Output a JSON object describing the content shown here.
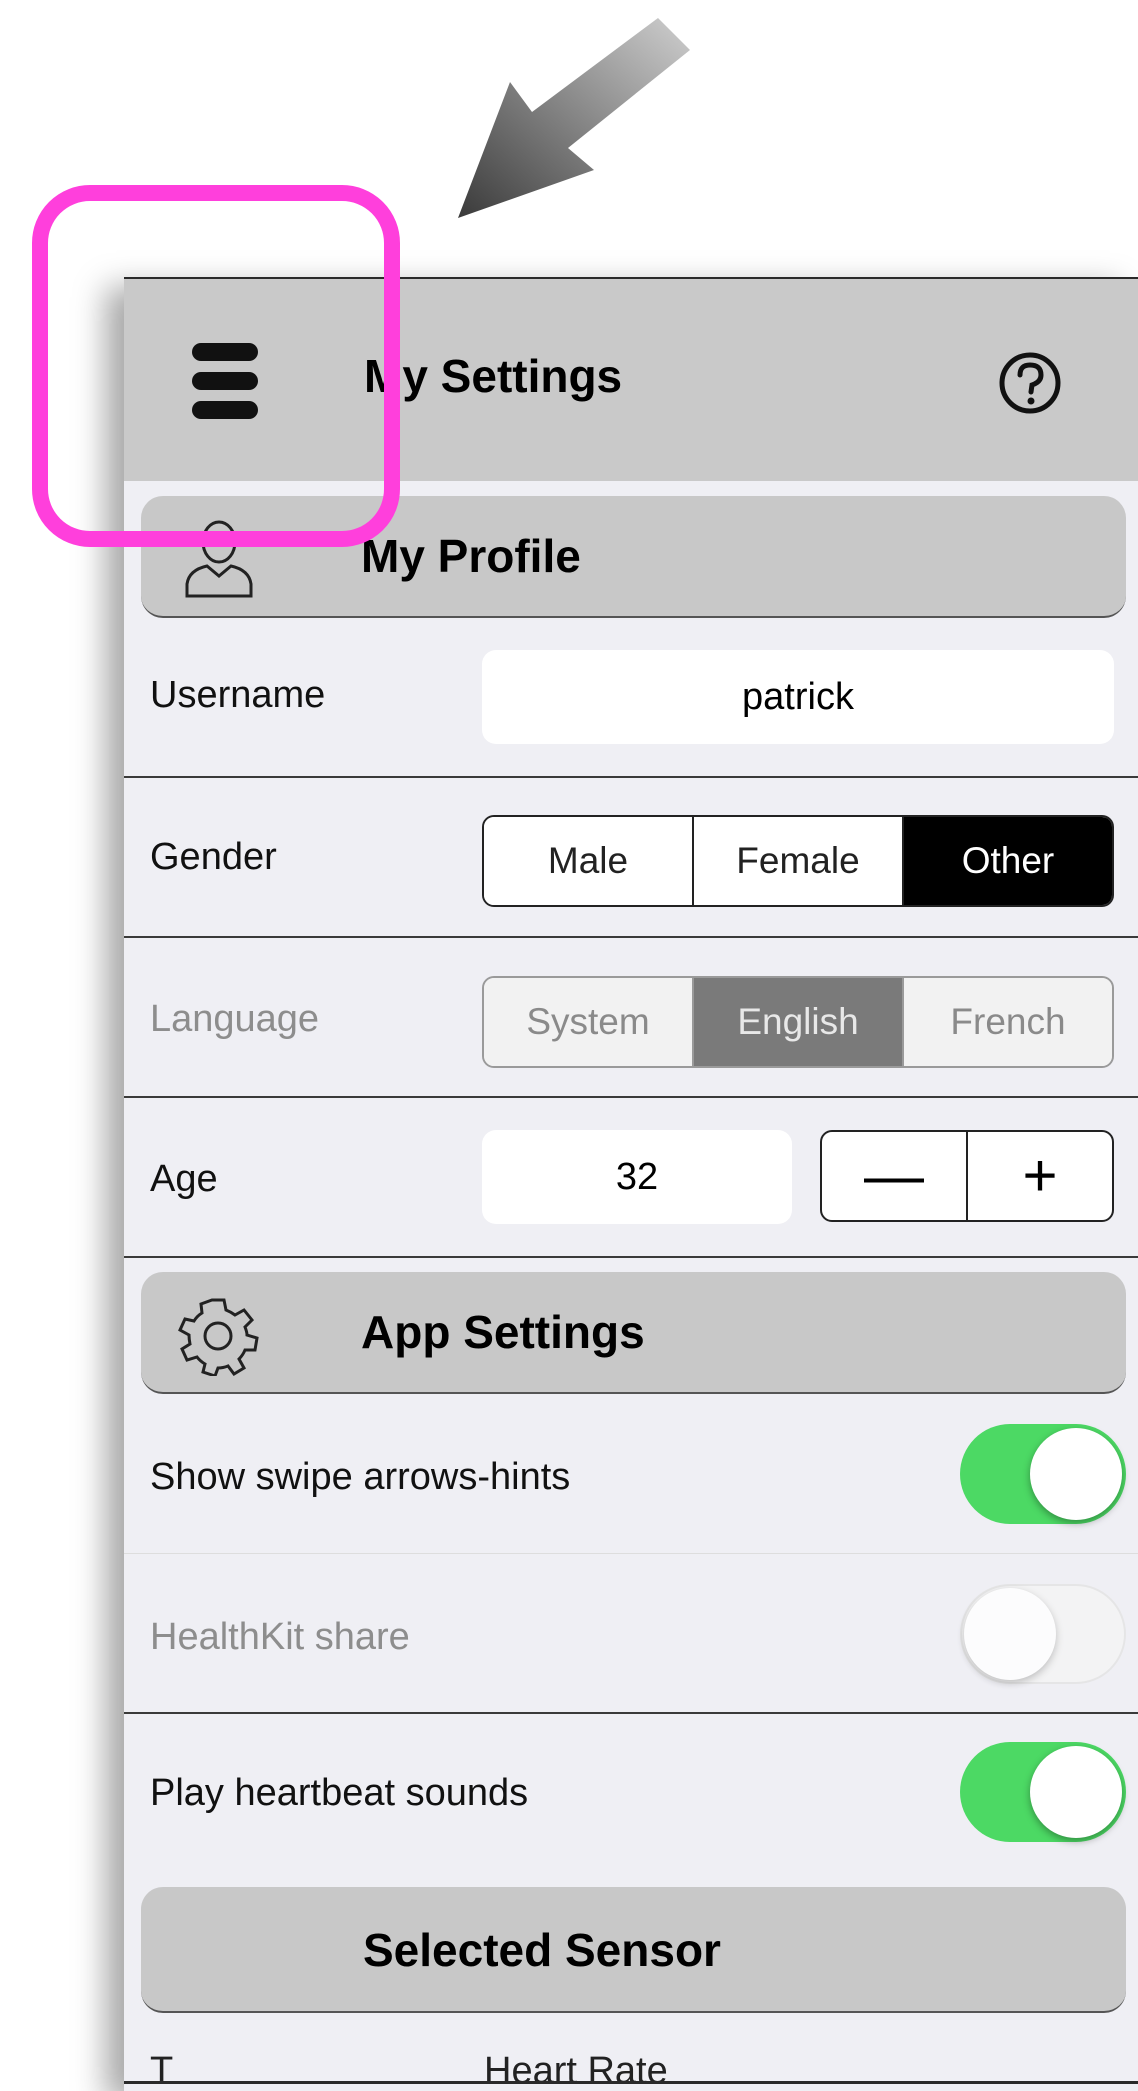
{
  "annotation": {
    "arrow_color": "#7a7a7a",
    "highlight_color": "#ff3fdc"
  },
  "navbar": {
    "title": "My Settings",
    "menu_icon": "hamburger-stack-icon",
    "help_icon": "question-circle-icon"
  },
  "profile_section": {
    "title": "My Profile",
    "icon": "user-outline-icon",
    "username": {
      "label": "Username",
      "value": "patrick"
    },
    "gender": {
      "label": "Gender",
      "options": [
        "Male",
        "Female",
        "Other"
      ],
      "selected": "Other"
    },
    "language": {
      "label": "Language",
      "options": [
        "System",
        "English",
        "French"
      ],
      "selected": "English",
      "enabled": false
    },
    "age": {
      "label": "Age",
      "value": "32",
      "decrement": "—",
      "increment": "+"
    }
  },
  "app_section": {
    "title": "App Settings",
    "icon": "gear-outline-icon",
    "toggles": [
      {
        "label": "Show swipe arrows-hints",
        "on": true,
        "enabled": true
      },
      {
        "label": "HealthKit share",
        "on": false,
        "enabled": false
      },
      {
        "label": "Play heartbeat sounds",
        "on": true,
        "enabled": true
      }
    ]
  },
  "sensor_section": {
    "title": "Selected Sensor",
    "next_row_label": "T",
    "next_row_value": "Heart Rate"
  },
  "colors": {
    "toggle_on": "#4cd964",
    "navbar_bg": "#c9c9c9",
    "section_header_bg": "#c8c8c8",
    "page_bg": "#efeff4"
  }
}
